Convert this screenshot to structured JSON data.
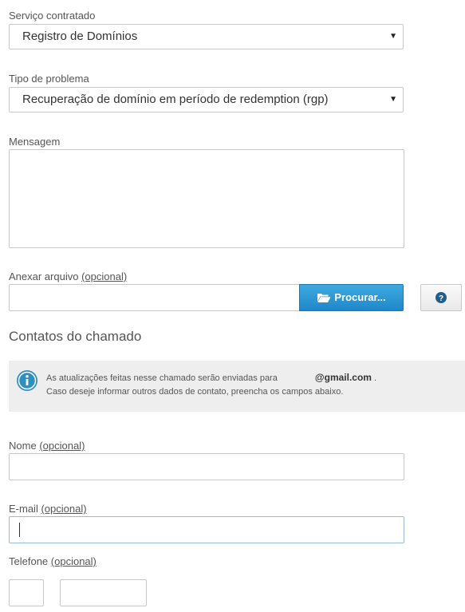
{
  "servico": {
    "label": "Serviço contratado",
    "value": "Registro de Domínios"
  },
  "tipo": {
    "label": "Tipo de problema",
    "value": "Recuperação de domínio em período de redemption (rgp)"
  },
  "mensagem": {
    "label": "Mensagem",
    "value": ""
  },
  "anexo": {
    "label": "Anexar arquivo",
    "optional": "(opcional)",
    "browse_label": "Procurar...",
    "help_icon": "question-circle-icon"
  },
  "contatos": {
    "title": "Contatos do chamado",
    "info_line1_prefix": "As atualizações feitas nesse chamado serão enviadas para",
    "email": "@gmail.com",
    "info_line1_suffix": ".",
    "info_line2": "Caso deseje informar outros dados de contato, preencha os campos abaixo."
  },
  "nome": {
    "label": "Nome",
    "optional": "(opcional)",
    "value": ""
  },
  "email_field": {
    "label": "E-mail",
    "optional": "(opcional)",
    "value": ""
  },
  "telefone": {
    "label": "Telefone",
    "optional": "(opcional)"
  },
  "colors": {
    "primary_button": "#2a95d5",
    "info_icon": "#2f8fbf",
    "help_icon": "#1f5f8b"
  }
}
